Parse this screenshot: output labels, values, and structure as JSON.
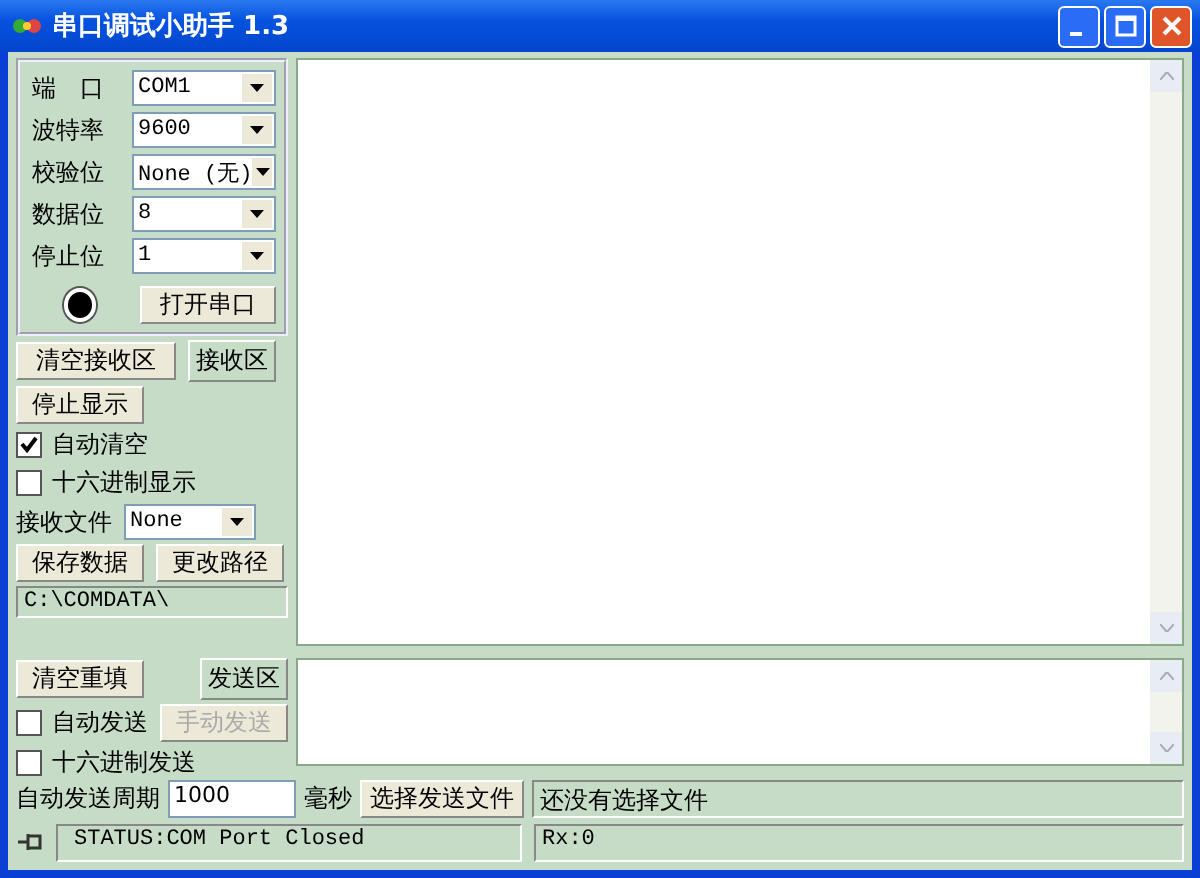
{
  "window": {
    "title": "串口调试小助手 1.3"
  },
  "serial_settings": [
    {
      "label": "端　口",
      "value": "COM1"
    },
    {
      "label": "波特率",
      "value": "9600"
    },
    {
      "label": "校验位",
      "value": "None (无)"
    },
    {
      "label": "数据位",
      "value": "8"
    },
    {
      "label": "停止位",
      "value": "1"
    }
  ],
  "port_indicator": {
    "on": false
  },
  "open_port_button": "打开串口",
  "receive": {
    "clear_button": "清空接收区",
    "area_label": "接收区",
    "stop_display_button": "停止显示",
    "options": [
      {
        "label": "自动清空",
        "checked": true
      },
      {
        "label": "十六进制显示",
        "checked": false
      }
    ],
    "file_label": "接收文件",
    "file_value": "None",
    "save_button": "保存数据",
    "change_path_button": "更改路径",
    "path": "C:\\COMDATA\\"
  },
  "send": {
    "clear_button": "清空重填",
    "area_label": "发送区",
    "auto_send": {
      "label": "自动发送",
      "checked": false
    },
    "manual_send_button": {
      "label": "手动发送",
      "disabled": true
    },
    "hex_send": {
      "label": "十六进制发送",
      "checked": false
    },
    "period_label": "自动发送周期",
    "period_value": "1000",
    "unit": "毫秒",
    "choose_file_button": "选择发送文件",
    "file_status": "还没有选择文件"
  },
  "status_bar": {
    "status": "STATUS:COM Port Closed",
    "rx": "Rx:0"
  }
}
